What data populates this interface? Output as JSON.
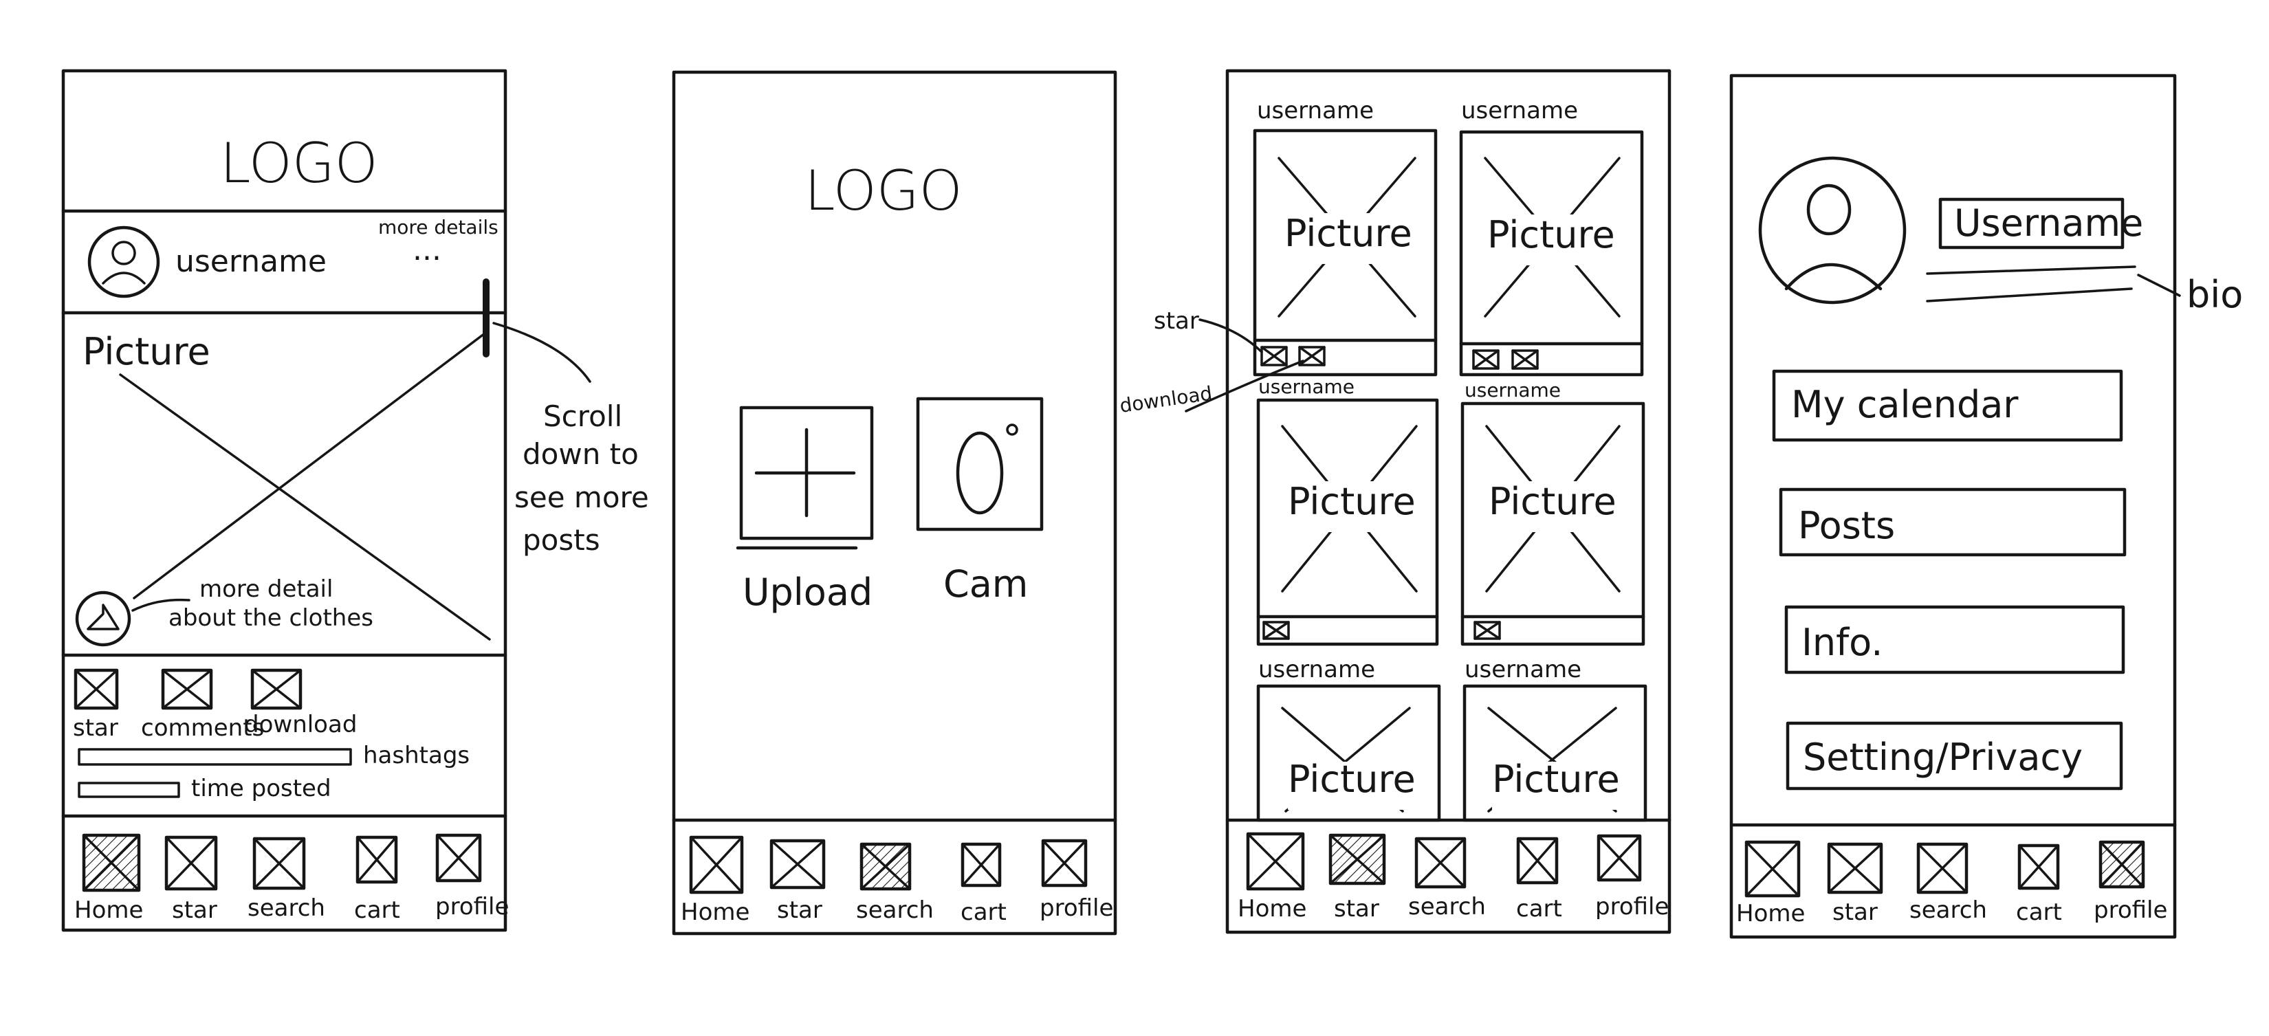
{
  "screens": [
    {
      "id": "feed",
      "logo": "LOGO",
      "username": "username",
      "more_details": "more details",
      "more_dots": "...",
      "picture": "Picture",
      "actions": [
        "star",
        "comments",
        "download"
      ],
      "hashtags": "hashtags",
      "time_posted": "time posted",
      "clothes_note": [
        "more detail",
        "about the clothes"
      ]
    },
    {
      "id": "upload",
      "logo": "LOGO",
      "upload_label": "Upload",
      "cam_label": "Cam"
    },
    {
      "id": "grid",
      "username": "username",
      "picture": "Picture",
      "star_note": "star",
      "download_note": "download"
    },
    {
      "id": "profile",
      "username": "Username",
      "bio_note": "bio",
      "menu": [
        "My calendar",
        "Posts",
        "Info.",
        "Setting/Privacy"
      ]
    }
  ],
  "nav_items": [
    "Home",
    "star",
    "search",
    "cart",
    "profile"
  ],
  "active_nav_per_screen": [
    "Home",
    "search",
    "star",
    "profile"
  ],
  "scroll_note": [
    "Scroll",
    "down to",
    "see more",
    "posts"
  ]
}
